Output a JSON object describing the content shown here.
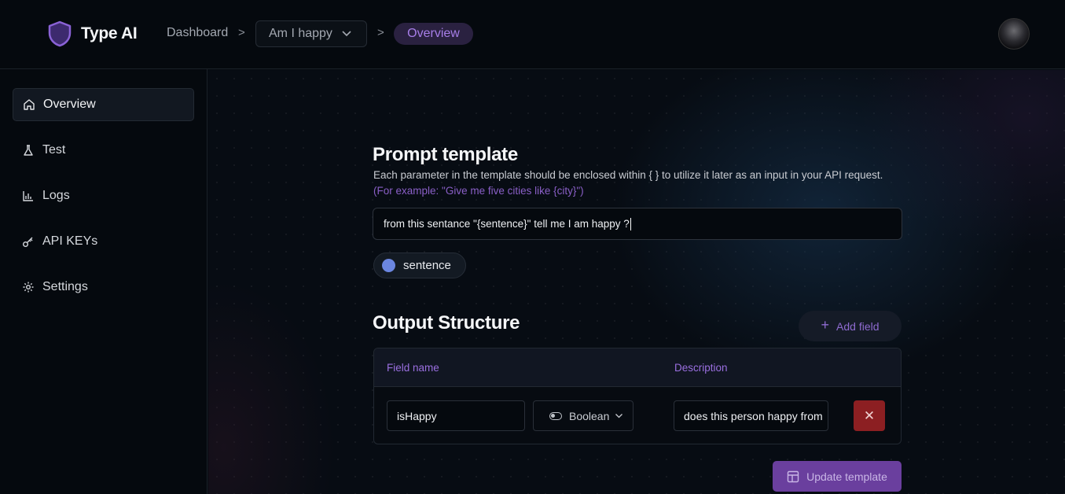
{
  "header": {
    "app_name": "Type AI",
    "breadcrumb": {
      "dashboard": "Dashboard",
      "project": "Am I happy",
      "current": "Overview",
      "separator": ">"
    }
  },
  "sidebar": {
    "items": [
      {
        "label": "Overview",
        "icon": "home-icon",
        "active": true
      },
      {
        "label": "Test",
        "icon": "flask-icon",
        "active": false
      },
      {
        "label": "Logs",
        "icon": "bar-chart-icon",
        "active": false
      },
      {
        "label": "API KEYs",
        "icon": "key-icon",
        "active": false
      },
      {
        "label": "Settings",
        "icon": "gear-icon",
        "active": false
      }
    ]
  },
  "prompt": {
    "title": "Prompt template",
    "description": "Each parameter in the template should be enclosed within { } to utilize it later as an input in your API request.",
    "example": "(For example: \"Give me five cities like {city}\")",
    "value": "from this sentance \"{sentence}\" tell me I am happy ?",
    "parameters": [
      "sentence"
    ]
  },
  "output": {
    "title": "Output Structure",
    "add_field_label": "Add field",
    "columns": [
      "Field name",
      "Description"
    ],
    "rows": [
      {
        "field_name": "isHappy",
        "type": "Boolean",
        "description": "does this person happy from"
      }
    ],
    "update_label": "Update template"
  },
  "colors": {
    "accent": "#9a6fe0",
    "delete": "#8c1f22",
    "param_dot": "#6b86e0"
  }
}
